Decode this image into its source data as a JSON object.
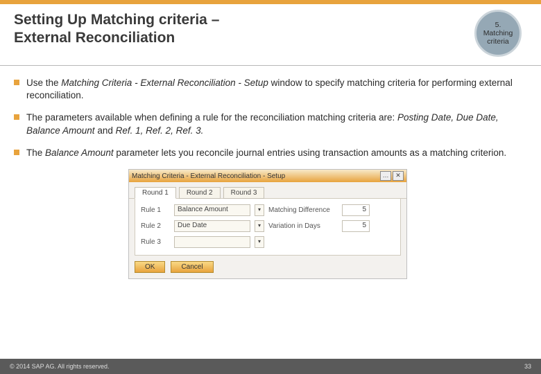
{
  "header": {
    "title_line1": "Setting Up Matching criteria –",
    "title_line2": "External Reconciliation",
    "badge_num": "5.",
    "badge_l1": "Matching",
    "badge_l2": "criteria"
  },
  "bullets": {
    "b1_a": "Use the ",
    "b1_i": "Matching Criteria - External Reconciliation - Setup",
    "b1_b": " window to specify matching criteria for performing external reconciliation.",
    "b2_a": "The parameters available when defining a rule for the reconciliation matching criteria are: ",
    "b2_i": "Posting Date, Due Date, Balance Amount",
    "b2_b": " and ",
    "b2_i2": "Ref. 1, Ref. 2, Ref. 3.",
    "b3_a": "The ",
    "b3_i": "Balance Amount",
    "b3_b": " parameter lets you reconcile journal entries using transaction amounts as a matching criterion."
  },
  "mock": {
    "title": "Matching Criteria - External Reconciliation - Setup",
    "ctrl_min": "…",
    "ctrl_close": "✕",
    "tab1": "Round 1",
    "tab2": "Round 2",
    "tab3": "Round 3",
    "rule1": "Rule 1",
    "rule2": "Rule 2",
    "rule3": "Rule 3",
    "sel1": "Balance Amount",
    "sel2": "Due Date",
    "sel3": "",
    "lab1": "Matching Difference",
    "lab2": "Variation in Days",
    "val1": "5",
    "val2": "5",
    "dd": "▾",
    "btn_ok": "OK",
    "btn_cancel": "Cancel"
  },
  "footer": {
    "copyright": "© 2014 SAP AG. All rights reserved.",
    "page": "33"
  }
}
